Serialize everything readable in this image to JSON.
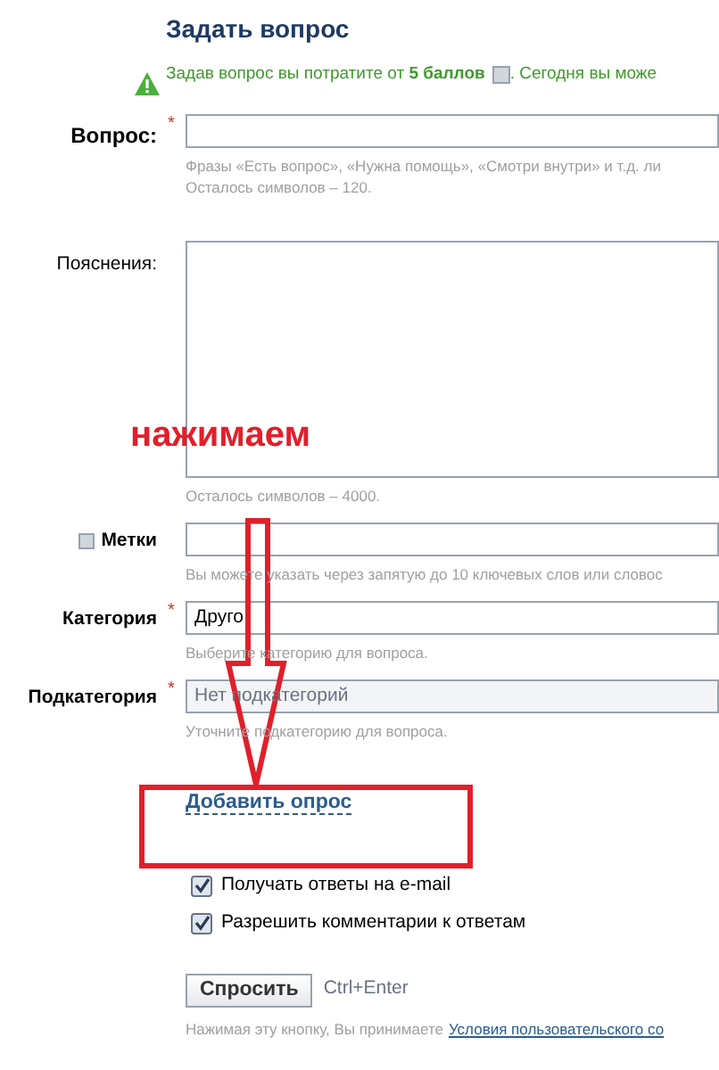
{
  "title": "Задать вопрос",
  "notice": {
    "text": "Задав вопрос вы потратите от **5 баллов**",
    "after": ". Сегодня вы може"
  },
  "fields": [
    {
      "kind": "text",
      "label": "Вопрос:",
      "required_mark": "*",
      "hints": [
        "Фразы «Есть вопрос», «Нужна помощь», «Смотри внутри» и т.д. ли",
        "Осталось символов – 120."
      ]
    },
    {
      "kind": "textarea",
      "label": "Пояснения:",
      "hints": [
        "Осталось символов – 4000."
      ]
    },
    {
      "kind": "tags",
      "label": "Метки",
      "hints": [
        "Вы можете указать через запятую до 10 ключевых слов или словос"
      ]
    },
    {
      "kind": "select",
      "label": "Категория",
      "required_mark": "*",
      "value": "Друго",
      "disabled": false,
      "hints": [
        "Выберите категорию для вопроса."
      ]
    },
    {
      "kind": "select",
      "label": "Подкатегория",
      "required_mark": "*",
      "value": "Нет подкатегорий",
      "disabled": true,
      "hints": [
        "Уточните подкатегорию для вопроса."
      ]
    }
  ],
  "add_poll_link": "Добавить опрос",
  "options": [
    {
      "label": "Получать ответы на e-mail",
      "checked": true
    },
    {
      "label": "Разрешить комментарии к ответам",
      "checked": true
    }
  ],
  "submit": {
    "label": "Спросить",
    "shortcut": "Ctrl+Enter"
  },
  "terms": {
    "text": "Нажимая эту кнопку, Вы принимаете",
    "link": "Условия пользовательского со"
  },
  "annotation": {
    "callout": "нажимаем"
  }
}
